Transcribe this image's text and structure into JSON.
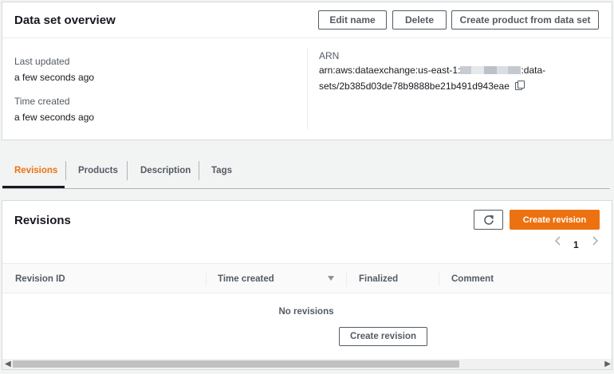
{
  "overview": {
    "title": "Data set overview",
    "buttons": {
      "edit_name": "Edit name",
      "delete": "Delete",
      "create_product": "Create product from data set"
    },
    "last_updated_label": "Last updated",
    "last_updated_value": "a few seconds ago",
    "time_created_label": "Time created",
    "time_created_value": "a few seconds ago",
    "arn_label": "ARN",
    "arn_prefix": "arn:aws:dataexchange:us-east-1:",
    "arn_suffix_line1": ":data-",
    "arn_line2": "sets/2b385d03de78b9888be21b491d943eae"
  },
  "tabs": [
    {
      "label": "Revisions",
      "active": true
    },
    {
      "label": "Products"
    },
    {
      "label": "Description"
    },
    {
      "label": "Tags"
    }
  ],
  "revisions": {
    "title": "Revisions",
    "create_button": "Create revision",
    "page_number": "1",
    "columns": [
      "Revision ID",
      "Time created",
      "Finalized",
      "Comment"
    ],
    "empty_text": "No revisions",
    "empty_create_button": "Create revision"
  },
  "colors": {
    "accent": "#ec7211",
    "text": "#16191f",
    "muted": "#545b64"
  },
  "icons": [
    "copy-icon",
    "refresh-icon",
    "chevron-left-icon",
    "chevron-right-icon",
    "sort-desc-icon"
  ]
}
